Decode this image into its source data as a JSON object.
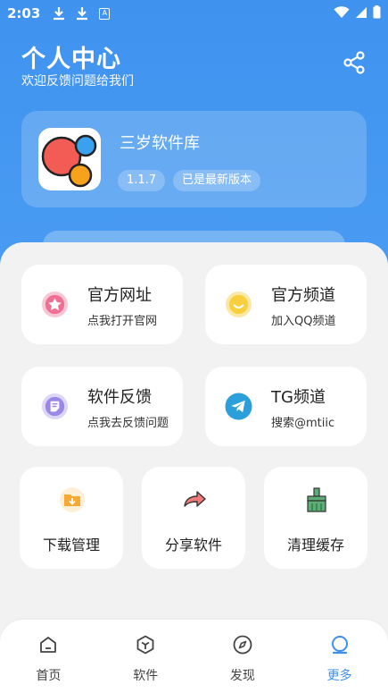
{
  "status_bar": {
    "time": "2:03",
    "badge": "A"
  },
  "header": {
    "title": "个人中心",
    "subtitle": "欢迎反馈问题给我们"
  },
  "app": {
    "name": "三岁软件库",
    "version": "1.1.7",
    "status": "已是最新版本"
  },
  "cards": {
    "official_site": {
      "title": "官方网址",
      "desc": "点我打开官网"
    },
    "official_channel": {
      "title": "官方频道",
      "desc": "加入QQ频道"
    },
    "feedback": {
      "title": "软件反馈",
      "desc": "点我去反馈问题"
    },
    "tg_channel": {
      "title": "TG频道",
      "desc": "搜索@mtiic"
    },
    "download": {
      "title": "下载管理"
    },
    "share": {
      "title": "分享软件"
    },
    "cache": {
      "title": "清理缓存"
    }
  },
  "nav": {
    "home": "首页",
    "software": "软件",
    "discover": "发现",
    "more": "更多",
    "active": "more"
  },
  "colors": {
    "primary": "#3f8ff0",
    "header_bg": "#4597f1"
  }
}
